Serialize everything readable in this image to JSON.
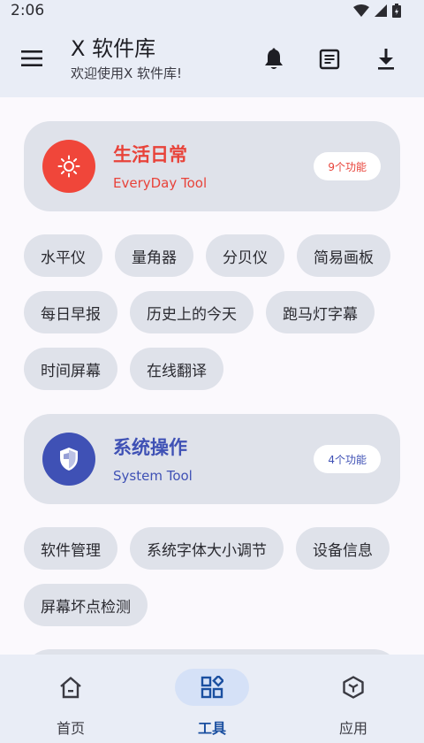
{
  "status_bar": {
    "time": "2:06"
  },
  "app_bar": {
    "title": "X 软件库",
    "subtitle": "欢迎使用X 软件库!"
  },
  "categories": [
    {
      "title": "生活日常",
      "subtitle": "EveryDay Tool",
      "badge": "9个功能",
      "color": "#f0463a",
      "icon": "sun-icon",
      "chip_rows": [
        [
          "水平仪",
          "量角器",
          "分贝仪",
          "简易画板"
        ],
        [
          "每日早报",
          "历史上的今天",
          "跑马灯字幕"
        ],
        [
          "时间屏幕",
          "在线翻译"
        ]
      ]
    },
    {
      "title": "系统操作",
      "subtitle": "System Tool",
      "badge": "4个功能",
      "color": "#3f51b5",
      "icon": "shield-icon",
      "chip_rows": [
        [
          "软件管理",
          "系统字体大小调节",
          "设备信息"
        ],
        [
          "屏幕坏点检测"
        ]
      ]
    }
  ],
  "bottom_nav": {
    "items": [
      {
        "label": "首页",
        "icon": "home-icon"
      },
      {
        "label": "工具",
        "icon": "grid-icon"
      },
      {
        "label": "应用",
        "icon": "cube-icon"
      }
    ],
    "active": "工具",
    "accent": "#1a4fa0"
  }
}
